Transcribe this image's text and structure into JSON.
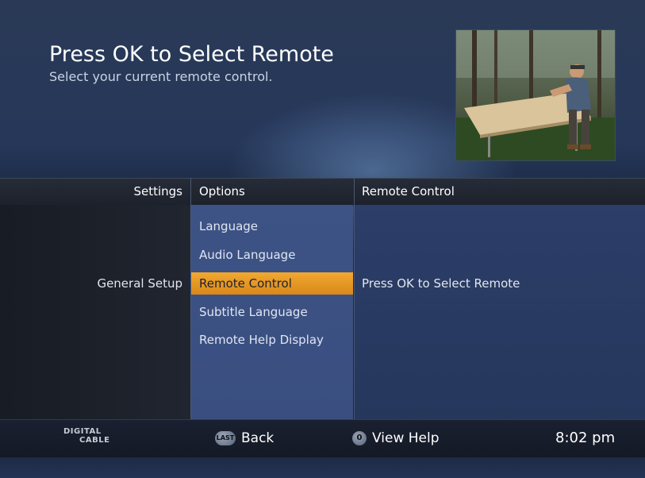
{
  "header": {
    "title": "Press OK to Select Remote",
    "subtitle": "Select your current remote control."
  },
  "columns": {
    "settings": "Settings",
    "options": "Options",
    "remote": "Remote Control"
  },
  "settings": {
    "selected": "General Setup"
  },
  "options": [
    {
      "label": "Language",
      "selected": false
    },
    {
      "label": "Audio Language",
      "selected": false
    },
    {
      "label": "Remote Control",
      "selected": true
    },
    {
      "label": "Subtitle Language",
      "selected": false
    },
    {
      "label": "Remote Help Display",
      "selected": false
    }
  ],
  "detail": {
    "text": "Press OK to Select Remote"
  },
  "footer": {
    "brand_top": "DIGITAL",
    "brand_bottom": "CABLE",
    "back_icon_text": "LAST",
    "back_label": "Back",
    "help_icon_text": "0",
    "help_label": "View Help",
    "time": "8:02 pm"
  },
  "colors": {
    "highlight": "#e59a25",
    "options_panel": "#3c5283",
    "detail_panel": "#2a3b64"
  },
  "icons": {
    "back": "last-button-icon",
    "help": "zero-button-icon"
  }
}
